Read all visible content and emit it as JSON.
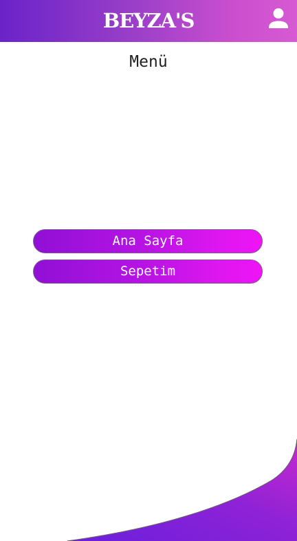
{
  "header": {
    "title": "BEYZA'S",
    "profile_icon": "person-icon"
  },
  "page": {
    "title": "Menü"
  },
  "menu": {
    "items": [
      {
        "label": "Ana Sayfa"
      },
      {
        "label": "Sepetim"
      }
    ]
  },
  "colors": {
    "header_gradient_start": "#6a23c9",
    "header_gradient_end": "#d65ad3",
    "button_gradient_start": "#9010d6",
    "button_gradient_end": "#ee14f6",
    "wave_gradient_start": "#7022d8",
    "wave_gradient_end": "#bf26d0"
  }
}
